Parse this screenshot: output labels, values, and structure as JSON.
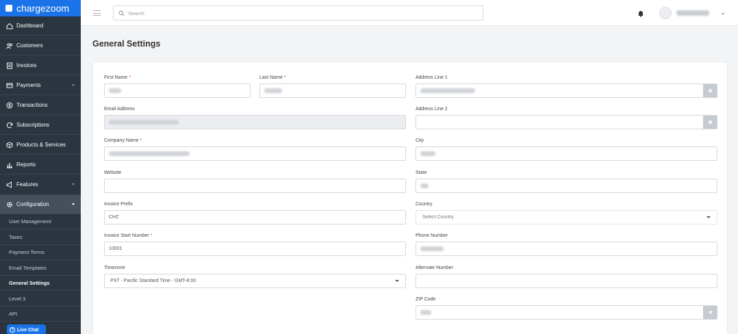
{
  "app": {
    "name": "chargezoom"
  },
  "sidebar": {
    "items": [
      {
        "label": "Dashboard",
        "icon": "home-icon"
      },
      {
        "label": "Customers",
        "icon": "users-icon"
      },
      {
        "label": "Invoices",
        "icon": "invoice-icon"
      },
      {
        "label": "Payments",
        "icon": "card-icon"
      },
      {
        "label": "Transactions",
        "icon": "dollar-icon"
      },
      {
        "label": "Subscriptions",
        "icon": "refresh-icon"
      },
      {
        "label": "Products & Services",
        "icon": "box-icon"
      },
      {
        "label": "Reports",
        "icon": "bar-chart-icon"
      },
      {
        "label": "Features",
        "icon": "megaphone-icon"
      },
      {
        "label": "Configuration",
        "icon": "gear-icon"
      }
    ],
    "subitems": [
      "User Management",
      "Taxes",
      "Payment Terms",
      "Email Templates",
      "General Settings",
      "Level 3",
      "API"
    ],
    "live_chat": "Live Chat"
  },
  "header": {
    "search_placeholder": "Search"
  },
  "page": {
    "title": "General Settings"
  },
  "form": {
    "first_name_label": "First Name",
    "last_name_label": "Last Name",
    "email_label": "Email Address",
    "company_label": "Company Name",
    "website_label": "Website",
    "prefix_label": "Invoice Prefix",
    "prefix_value": "CHZ",
    "start_label": "Invoice Start Number",
    "start_value": "10001",
    "timezone_label": "Timezone",
    "timezone_value": "PST - Pacific Standard Time - GMT-8:00",
    "address1_label": "Address Line 1",
    "address2_label": "Address Line 2",
    "city_label": "City",
    "state_label": "State",
    "country_label": "Country",
    "country_value": "Select Country",
    "phone_label": "Phone Number",
    "alt_label": "Alternate Number",
    "zip_label": "ZIP Code",
    "required_mark": "*"
  },
  "colors": {
    "sidebar": "#2b3540",
    "accent": "#1a73e8",
    "active": "#45505c"
  }
}
